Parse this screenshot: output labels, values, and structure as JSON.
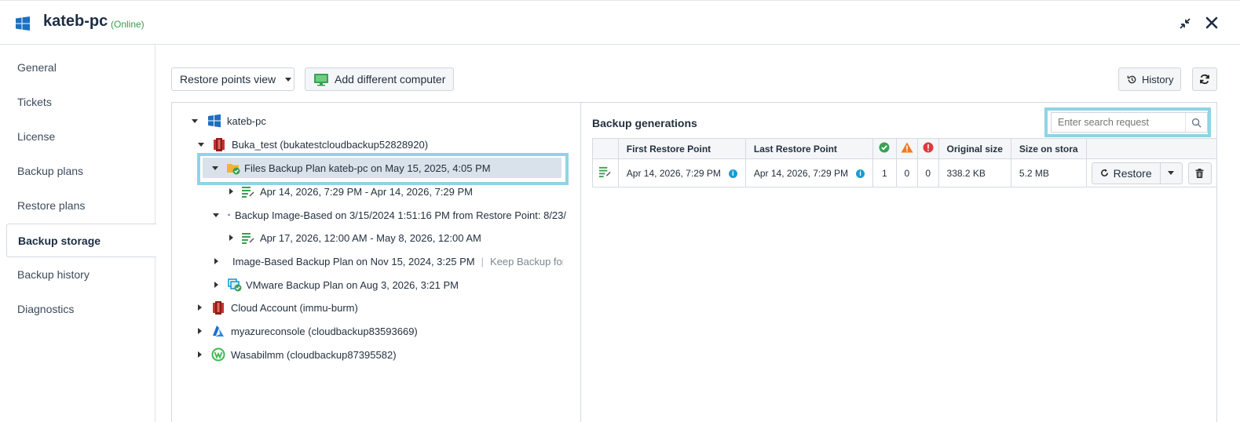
{
  "header": {
    "title": "kateb-pc",
    "status": "(Online)",
    "icons": {
      "os": "windows-icon",
      "collapse": "collapse-icon",
      "close": "close-icon"
    }
  },
  "sidebar": {
    "items": [
      {
        "label": "General"
      },
      {
        "label": "Tickets"
      },
      {
        "label": "License"
      },
      {
        "label": "Backup plans"
      },
      {
        "label": "Restore plans"
      },
      {
        "label": "Backup storage",
        "active": true
      },
      {
        "label": "Backup history"
      },
      {
        "label": "Diagnostics"
      }
    ]
  },
  "toolbar": {
    "view_select": "Restore points view",
    "add_computer": "Add different computer",
    "history": "History"
  },
  "tree": {
    "root": "kateb-pc",
    "storage1": "Buka_test (bukatestcloudbackup52828920)",
    "plan_files": "Files Backup Plan kateb-pc on May 15, 2025, 4:05 PM",
    "files_rp": "Apr 14, 2026, 7:29 PM - Apr 14, 2026, 7:29 PM",
    "plan_image": "Backup Image-Based on 3/15/2024 1:51:16 PM from Restore Point: 8/23/",
    "image_rp": "Apr 17, 2026, 12:00 AM - May 8, 2026, 12:00 AM",
    "plan_image2": "Image-Based Backup Plan on Nov 15, 2024, 3:25 PM",
    "plan_image2_extra": "Keep Backup for '",
    "plan_vmware": "VMware Backup Plan on Aug 3, 2026, 3:21 PM",
    "storage2": "Cloud Account (immu-burm)",
    "storage3": "myazureconsole (cloudbackup83593669)",
    "storage4": "Wasabilmm (cloudbackup87395582)"
  },
  "generations": {
    "title": "Backup generations",
    "search_placeholder": "Enter search request",
    "columns": {
      "first": "First Restore Point",
      "last": "Last Restore Point",
      "original": "Original size",
      "storage": "Size on stora"
    },
    "row": {
      "first": "Apr 14, 2026, 7:29 PM",
      "last": "Apr 14, 2026, 7:29 PM",
      "success": "1",
      "warning": "0",
      "error": "0",
      "original": "338.2 KB",
      "storage": "5.2 MB",
      "restore": "Restore"
    }
  },
  "colors": {
    "accent_highlight": "#8fd3e6",
    "online": "#3a9c4f",
    "success": "#3aa055",
    "warning": "#f07a22",
    "error": "#e0393e",
    "info": "#1a9bd4"
  }
}
